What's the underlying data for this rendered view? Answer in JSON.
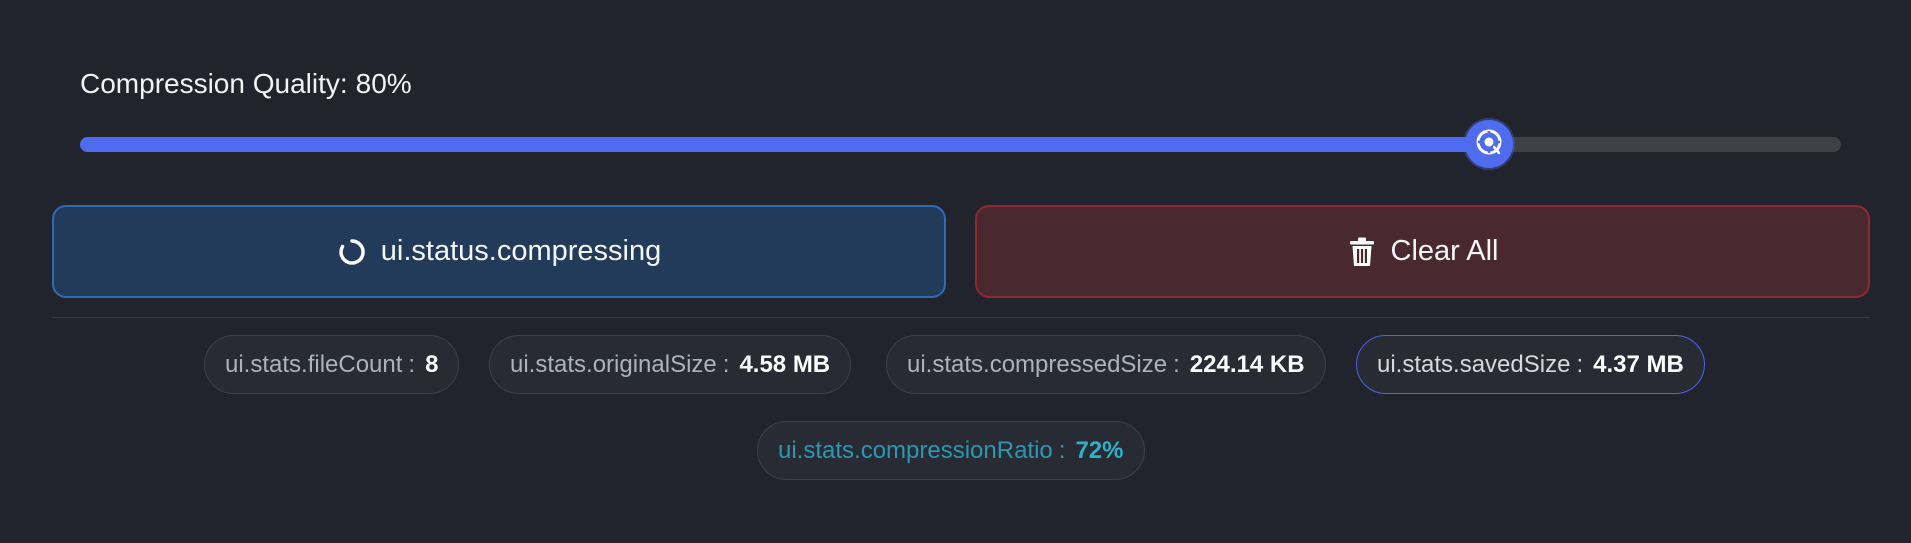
{
  "quality": {
    "label": "Compression Quality:",
    "value_text": "80%",
    "value": 0.8
  },
  "actions": {
    "compress_label": "ui.status.compressing",
    "clear_label": "Clear All"
  },
  "stats": {
    "file_count": {
      "key": "ui.stats.fileCount",
      "sep": ":",
      "value": "8"
    },
    "original_size": {
      "key": "ui.stats.originalSize",
      "sep": ":",
      "value": "4.58 MB"
    },
    "compressed_size": {
      "key": "ui.stats.compressedSize",
      "sep": ":",
      "value": "224.14 KB"
    },
    "saved_size": {
      "key": "ui.stats.savedSize",
      "sep": ":",
      "value": "4.37 MB"
    },
    "compression_ratio": {
      "key": "ui.stats.compressionRatio",
      "sep": ":",
      "value": "72%"
    }
  },
  "icons": {
    "slider_thumb": "compass-icon",
    "compress": "spinner-icon",
    "clear": "trash-icon"
  },
  "colors": {
    "accent": "#4f6cf0",
    "compress_bg": "#233b5b",
    "clear_bg": "#4a2830",
    "ratio_accent": "#2fb1c9"
  }
}
